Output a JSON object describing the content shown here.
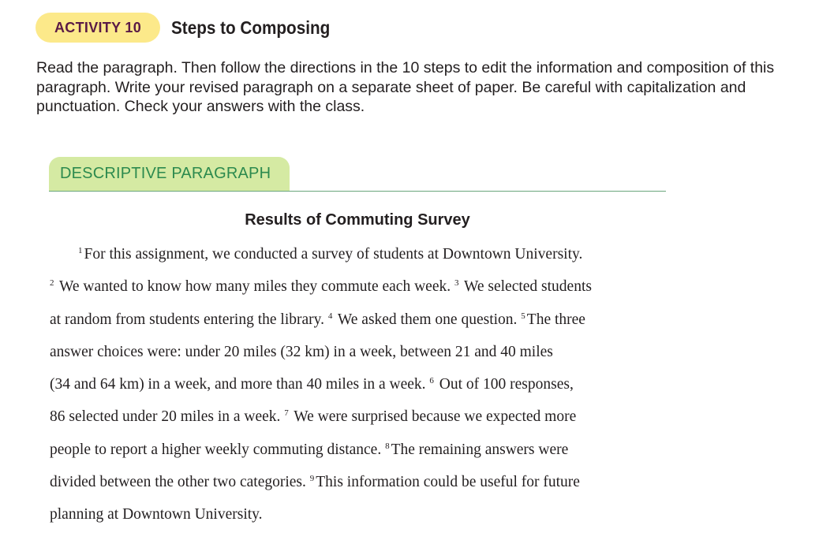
{
  "activity": {
    "badge": "ACTIVITY 10",
    "title": "Steps to Composing"
  },
  "instructions": "Read the paragraph. Then follow the directions in the 10 steps to edit the information and composition of this paragraph. Write your revised paragraph on a separate sheet of paper. Be careful with capitalization and punctuation. Check your answers with the class.",
  "section": {
    "label": "DESCRIPTIVE PARAGRAPH"
  },
  "paragraph": {
    "title": "Results of Commuting Survey",
    "lines": [
      [
        {
          "sup": "1",
          "text": "For this assignment, we conducted a survey of students at Downtown University."
        }
      ],
      [
        {
          "sup": "2",
          "text": " We wanted to know how many miles they commute each week. "
        },
        {
          "sup": "3",
          "text": " We selected students"
        }
      ],
      [
        {
          "text": "at random from students entering the library. "
        },
        {
          "sup": "4",
          "text": " We asked them one question. "
        },
        {
          "sup": "5",
          "text": "The three"
        }
      ],
      [
        {
          "text": "answer choices were: under 20 miles (32 km) in a week, between 21 and 40 miles"
        }
      ],
      [
        {
          "text": "(34 and 64 km) in a week, and more than 40 miles in a week. "
        },
        {
          "sup": "6",
          "text": " Out of 100 responses,"
        }
      ],
      [
        {
          "text": "86 selected under 20 miles in a week. "
        },
        {
          "sup": "7",
          "text": " We were surprised because we expected more"
        }
      ],
      [
        {
          "text": "people to report a higher weekly commuting distance. "
        },
        {
          "sup": "8",
          "text": "The remaining answers were"
        }
      ],
      [
        {
          "text": "divided between the other two categories. "
        },
        {
          "sup": "9",
          "text": "This information could be useful for future"
        }
      ],
      [
        {
          "text": "planning at Downtown University."
        }
      ]
    ]
  }
}
